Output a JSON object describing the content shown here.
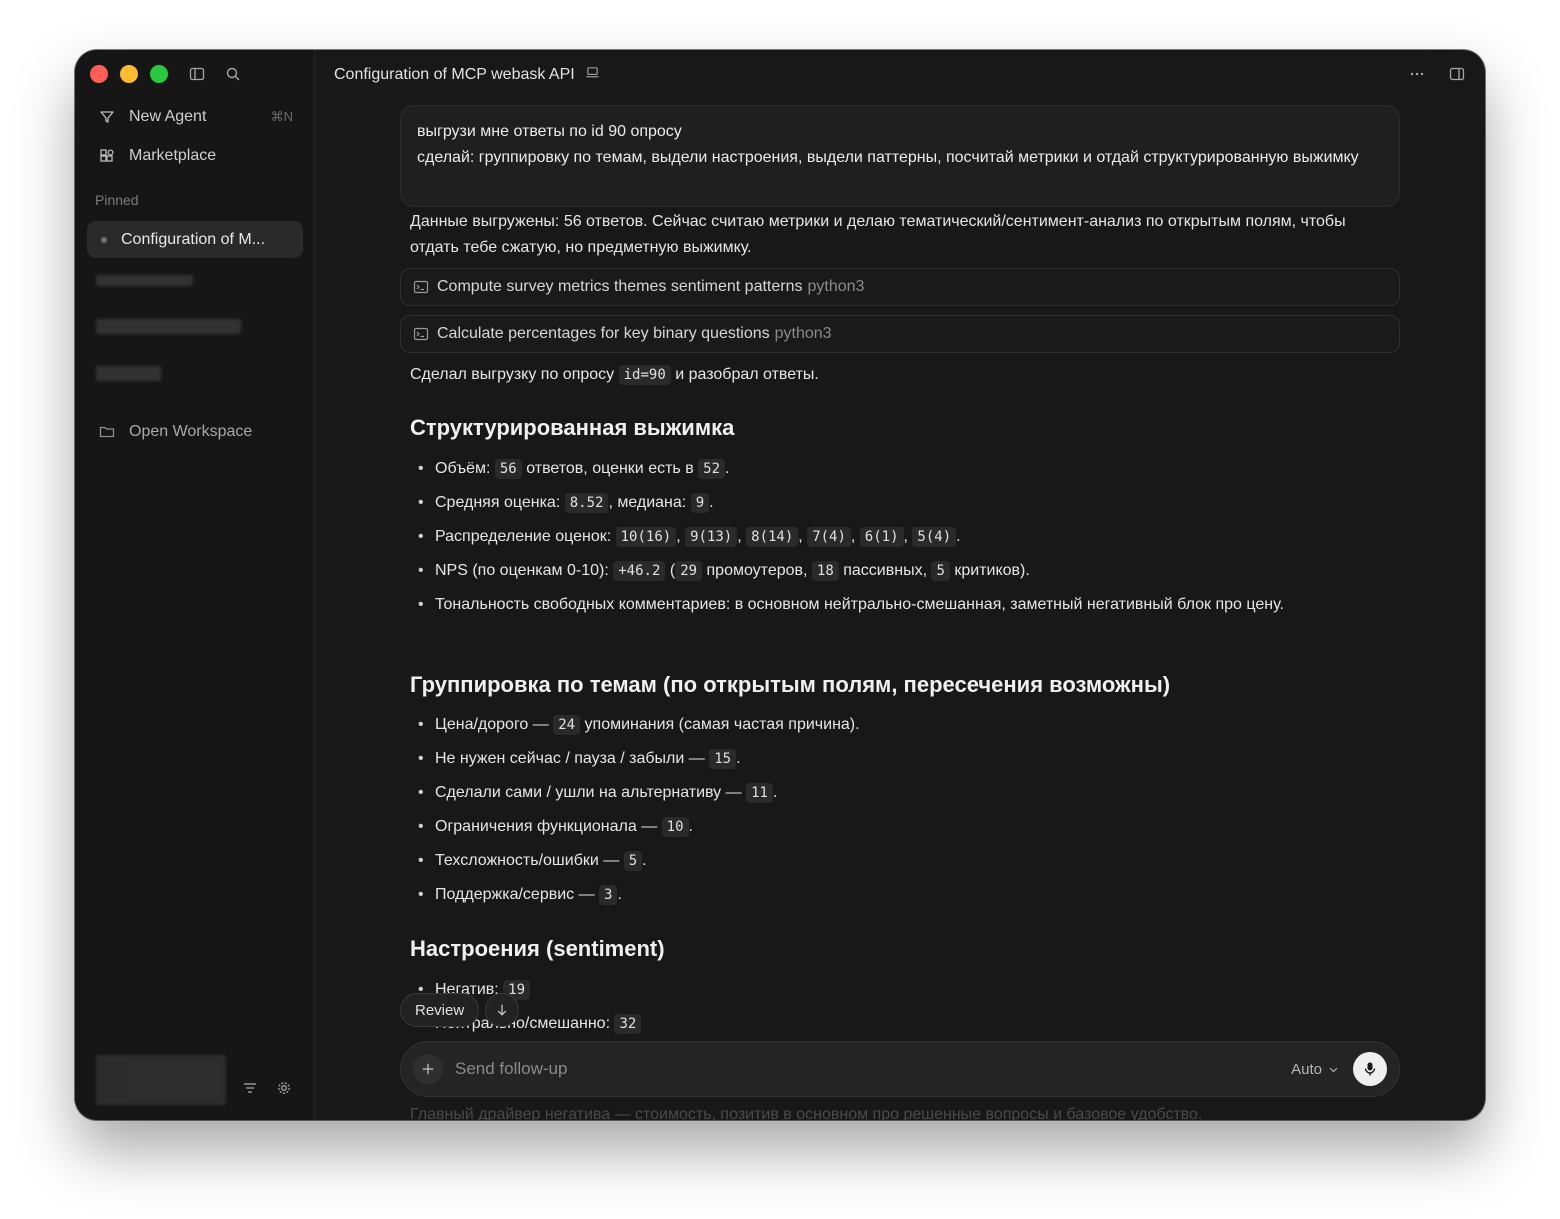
{
  "window_title": "Configuration of MCP webask API",
  "sidebar": {
    "new_agent": "New Agent",
    "new_agent_shortcut": "⌘N",
    "marketplace": "Marketplace",
    "pinned_label": "Pinned",
    "pinned_item": "Configuration of M...",
    "open_workspace": "Open Workspace"
  },
  "user_message": {
    "line1": "выгрузи мне ответы по id 90 опросу",
    "line2": "сделай: группировку по темам, выдели настроения, выдели паттерны, посчитай метрики и отдай структурированную выжимку"
  },
  "assistant": {
    "intro": "Данные выгружены: 56 ответов. Сейчас считаю метрики и делаю тематический/сентимент-анализ по открытым полям, чтобы отдать тебе сжатую, но предметную выжимку.",
    "tool1": {
      "label": "Compute survey metrics themes sentiment patterns",
      "lang": "python3"
    },
    "tool2": {
      "label": "Calculate percentages for key binary questions",
      "lang": "python3"
    },
    "done_pre": "Сделал выгрузку по опросу",
    "done_code": "id=90",
    "done_post": "и разобрал ответы.",
    "summary_heading": "Структурированная выжимка",
    "summary": {
      "volume_a": "Объём:",
      "volume_n": "56",
      "volume_b": "ответов, оценки есть в",
      "volume_m": "52",
      "volume_end": ".",
      "avg_a": "Средняя оценка:",
      "avg_v": "8.52",
      "avg_b": ", медиана:",
      "avg_m": "9",
      "avg_end": ".",
      "dist_label": "Распределение оценок:",
      "dist": [
        "10(16)",
        "9(13)",
        "8(14)",
        "7(4)",
        "6(1)",
        "5(4)"
      ],
      "nps_a": "NPS (по оценкам 0-10):",
      "nps_v": "+46.2",
      "nps_b": "(",
      "nps_p": "29",
      "nps_c": "промоутеров,",
      "nps_s": "18",
      "nps_d": "пассивных,",
      "nps_k": "5",
      "nps_e": "критиков).",
      "tone": "Тональность свободных комментариев: в основном нейтрально-смешанная, заметный негативный блок про цену."
    },
    "themes_heading": "Группировка по темам (по открытым полям, пересечения возможны)",
    "themes": [
      {
        "pre": "Цена/дорого —",
        "n": "24",
        "post": "упоминания (самая частая причина)."
      },
      {
        "pre": "Не нужен сейчас / пауза / забыли —",
        "n": "15",
        "post": "."
      },
      {
        "pre": "Сделали сами / ушли на альтернативу —",
        "n": "11",
        "post": "."
      },
      {
        "pre": "Ограничения функционала —",
        "n": "10",
        "post": "."
      },
      {
        "pre": "Техсложность/ошибки —",
        "n": "5",
        "post": "."
      },
      {
        "pre": "Поддержка/сервис —",
        "n": "3",
        "post": "."
      }
    ],
    "sentiment_heading": "Настроения (sentiment)",
    "sentiment": [
      {
        "label": "Негатив:",
        "n": "19"
      },
      {
        "label": "Нейтрально/смешанно:",
        "n": "32"
      }
    ]
  },
  "review_button": "Review",
  "composer": {
    "placeholder": "Send follow-up",
    "model": "Auto"
  },
  "under_text": "Главный драйвер негатива — стоимость, позитив в основном про решенные вопросы и базовое удобство."
}
